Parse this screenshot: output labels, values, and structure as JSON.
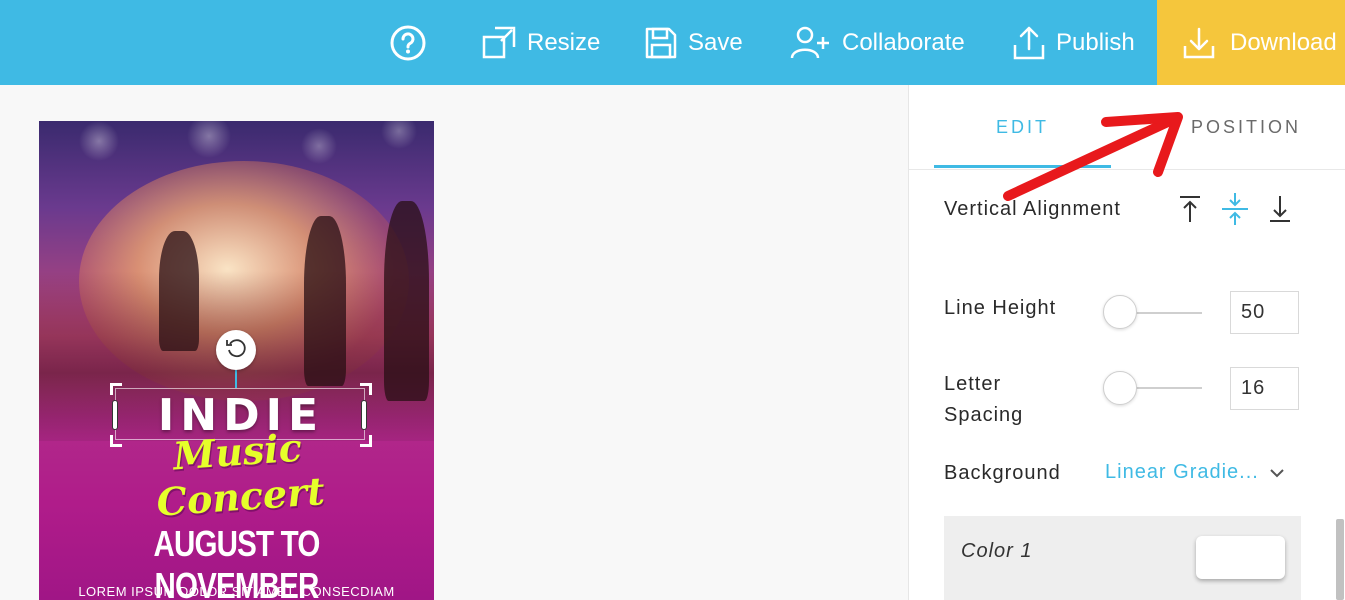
{
  "toolbar": {
    "help_icon": "question-circle-icon",
    "resize_label": "Resize",
    "save_label": "Save",
    "collaborate_label": "Collaborate",
    "publish_label": "Publish",
    "download_label": "Download",
    "colors": {
      "bar": "#3fbae4",
      "download_bg": "#f5c63c"
    }
  },
  "poster": {
    "headline": "INDIE",
    "subheadline": "Music Concert",
    "date_line": "AUGUST TO NOVEMBER",
    "body_line": "LOREM IPSUM DOLOR SIT AMET, CONSECDIAM"
  },
  "panel": {
    "tabs": [
      {
        "label": "EDIT",
        "active": true
      },
      {
        "label": "POSITION",
        "active": false
      }
    ],
    "vertical_alignment": {
      "label": "Vertical Alignment",
      "options": [
        "align-top-icon",
        "align-middle-icon",
        "align-bottom-icon"
      ],
      "selected": "align-middle-icon"
    },
    "line_height": {
      "label": "Line Height",
      "value": "50"
    },
    "letter_spacing": {
      "label": "Letter\nSpacing",
      "value": "16"
    },
    "background": {
      "label": "Background",
      "value": "Linear Gradie..."
    },
    "color1": {
      "label": "Color 1",
      "swatch": "#ffffff"
    },
    "accent": "#3fbae4"
  },
  "annotation": {
    "arrow_color": "#e8191c"
  }
}
